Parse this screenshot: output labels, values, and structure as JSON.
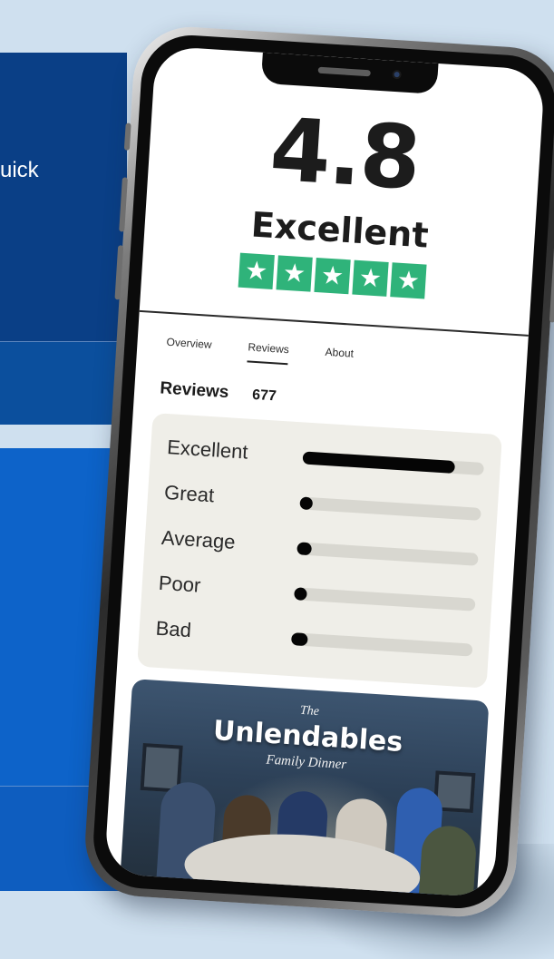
{
  "background": {
    "partial_text": "uick"
  },
  "rating": {
    "score": "4.8",
    "label": "Excellent",
    "stars": 5,
    "star_glyph": "★",
    "star_color": "#2fb37a"
  },
  "tabs": [
    {
      "label": "Overview",
      "active": false
    },
    {
      "label": "Reviews",
      "active": true
    },
    {
      "label": "About",
      "active": false
    }
  ],
  "reviews": {
    "title": "Reviews",
    "count": "677"
  },
  "breakdown": [
    {
      "label": "Excellent",
      "fraction": 0.84
    },
    {
      "label": "Great",
      "fraction": 0.06
    },
    {
      "label": "Average",
      "fraction": 0.08
    },
    {
      "label": "Poor",
      "fraction": 0.05
    },
    {
      "label": "Bad",
      "fraction": 0.09
    }
  ],
  "poster": {
    "pretitle": "The",
    "title": "Unlendables",
    "subtitle": "Family Dinner"
  }
}
